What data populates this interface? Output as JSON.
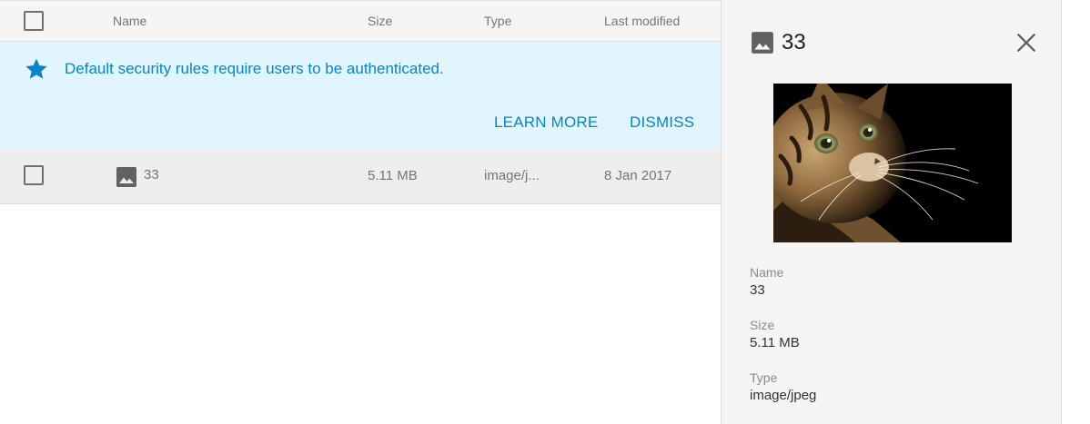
{
  "table": {
    "columns": {
      "name": "Name",
      "size": "Size",
      "type": "Type",
      "modified": "Last modified"
    }
  },
  "banner": {
    "icon": "star-icon",
    "message": "Default security rules require users to be authenticated.",
    "learn_more_label": "LEARN MORE",
    "dismiss_label": "DISMISS",
    "accent_color": "#0a83c9",
    "background_color": "#e1f5fe"
  },
  "files": [
    {
      "icon": "image-icon",
      "name": "33",
      "size": "5.11 MB",
      "type": "image/j...",
      "modified": "8 Jan 2017",
      "selected": false
    }
  ],
  "details": {
    "icon": "image-icon",
    "title": "33",
    "close_icon": "close-icon",
    "preview": "kitten-photo",
    "fields": {
      "name_label": "Name",
      "name_value": "33",
      "size_label": "Size",
      "size_value": "5.11 MB",
      "type_label": "Type",
      "type_value": "image/jpeg"
    }
  }
}
